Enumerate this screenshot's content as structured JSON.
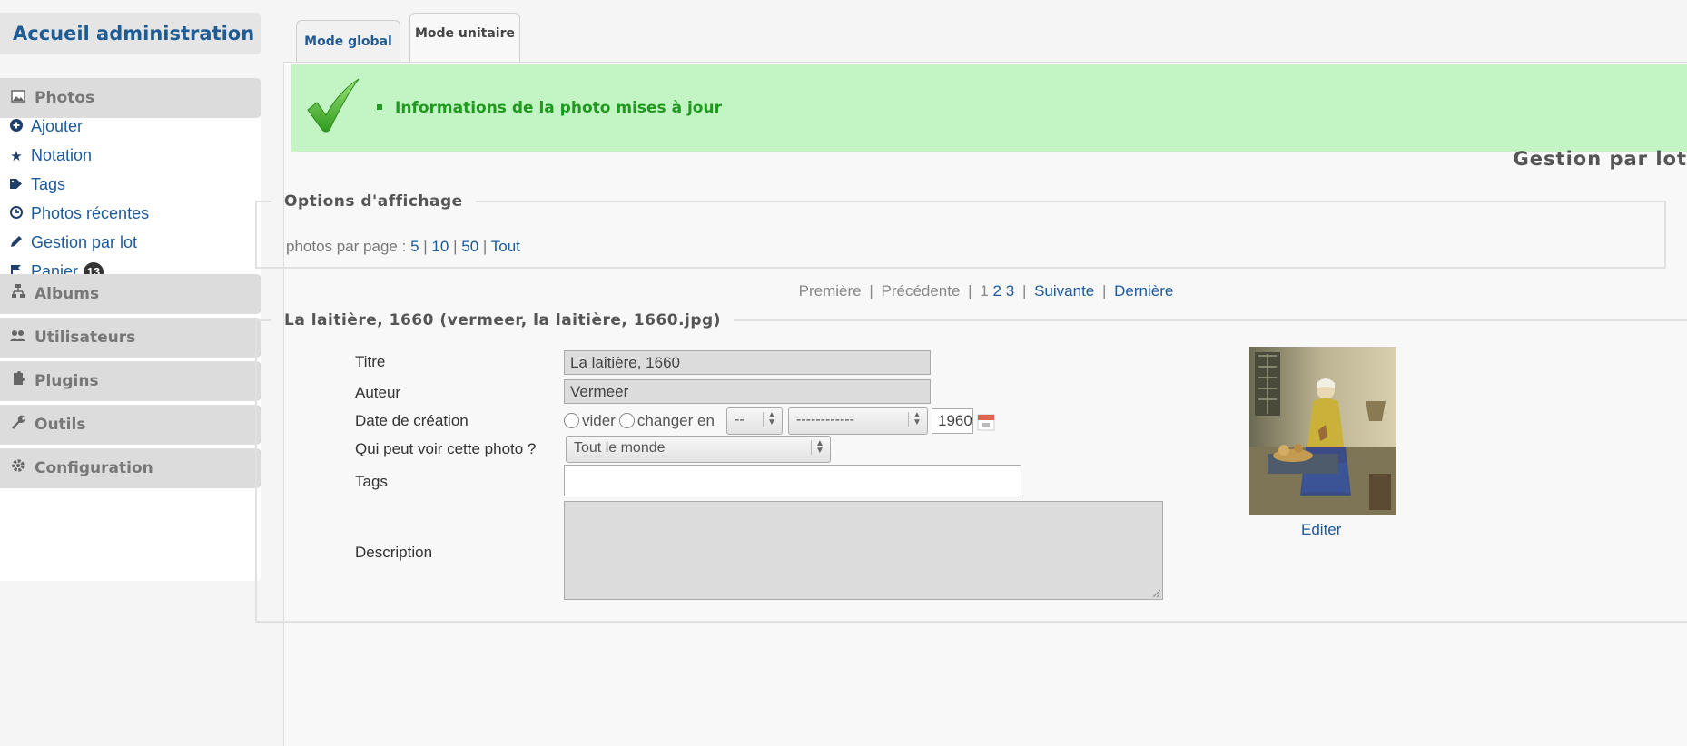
{
  "sidebar": {
    "home_label": "Accueil administration",
    "sections": {
      "photos": "Photos",
      "albums": "Albums",
      "users": "Utilisateurs",
      "plugins": "Plugins",
      "tools": "Outils",
      "config": "Configuration"
    },
    "photo_items": [
      {
        "label": "Ajouter",
        "icon": "plus-circle-icon"
      },
      {
        "label": "Notation",
        "icon": "star-icon"
      },
      {
        "label": "Tags",
        "icon": "tag-icon"
      },
      {
        "label": "Photos récentes",
        "icon": "clock-icon"
      },
      {
        "label": "Gestion par lot",
        "icon": "pencil-icon"
      },
      {
        "label": "Panier",
        "icon": "flag-icon"
      }
    ],
    "cart_count": "13"
  },
  "tabs": {
    "global": "Mode global",
    "unit": "Mode unitaire"
  },
  "success": {
    "message": "Informations de la photo mises à jour",
    "color": "#c2f5c3"
  },
  "page_title": "Gestion par lot",
  "options": {
    "legend": "Options d'affichage",
    "per_page_label": "photos par page :",
    "per_page_values": [
      "5",
      "10",
      "50",
      "Tout"
    ]
  },
  "pagination": {
    "first": "Première",
    "prev": "Précédente",
    "pages": [
      "1",
      "2",
      "3"
    ],
    "next": "Suivante",
    "last": "Dernière"
  },
  "photo": {
    "legend": "La laitière, 1660 (vermeer, la laitière, 1660.jpg)",
    "title_label": "Titre",
    "title_value": "La laitière, 1660",
    "author_label": "Auteur",
    "author_value": "Vermeer",
    "date_label": "Date de création",
    "radio_clear": "vider",
    "radio_change": "changer en",
    "day_value": "--",
    "month_value": "------------",
    "year_value": "1960",
    "privacy_label": "Qui peut voir cette photo ?",
    "privacy_value": "Tout le monde",
    "tags_label": "Tags",
    "tags_value": "",
    "description_label": "Description",
    "description_value": "",
    "edit_link": "Editer"
  }
}
